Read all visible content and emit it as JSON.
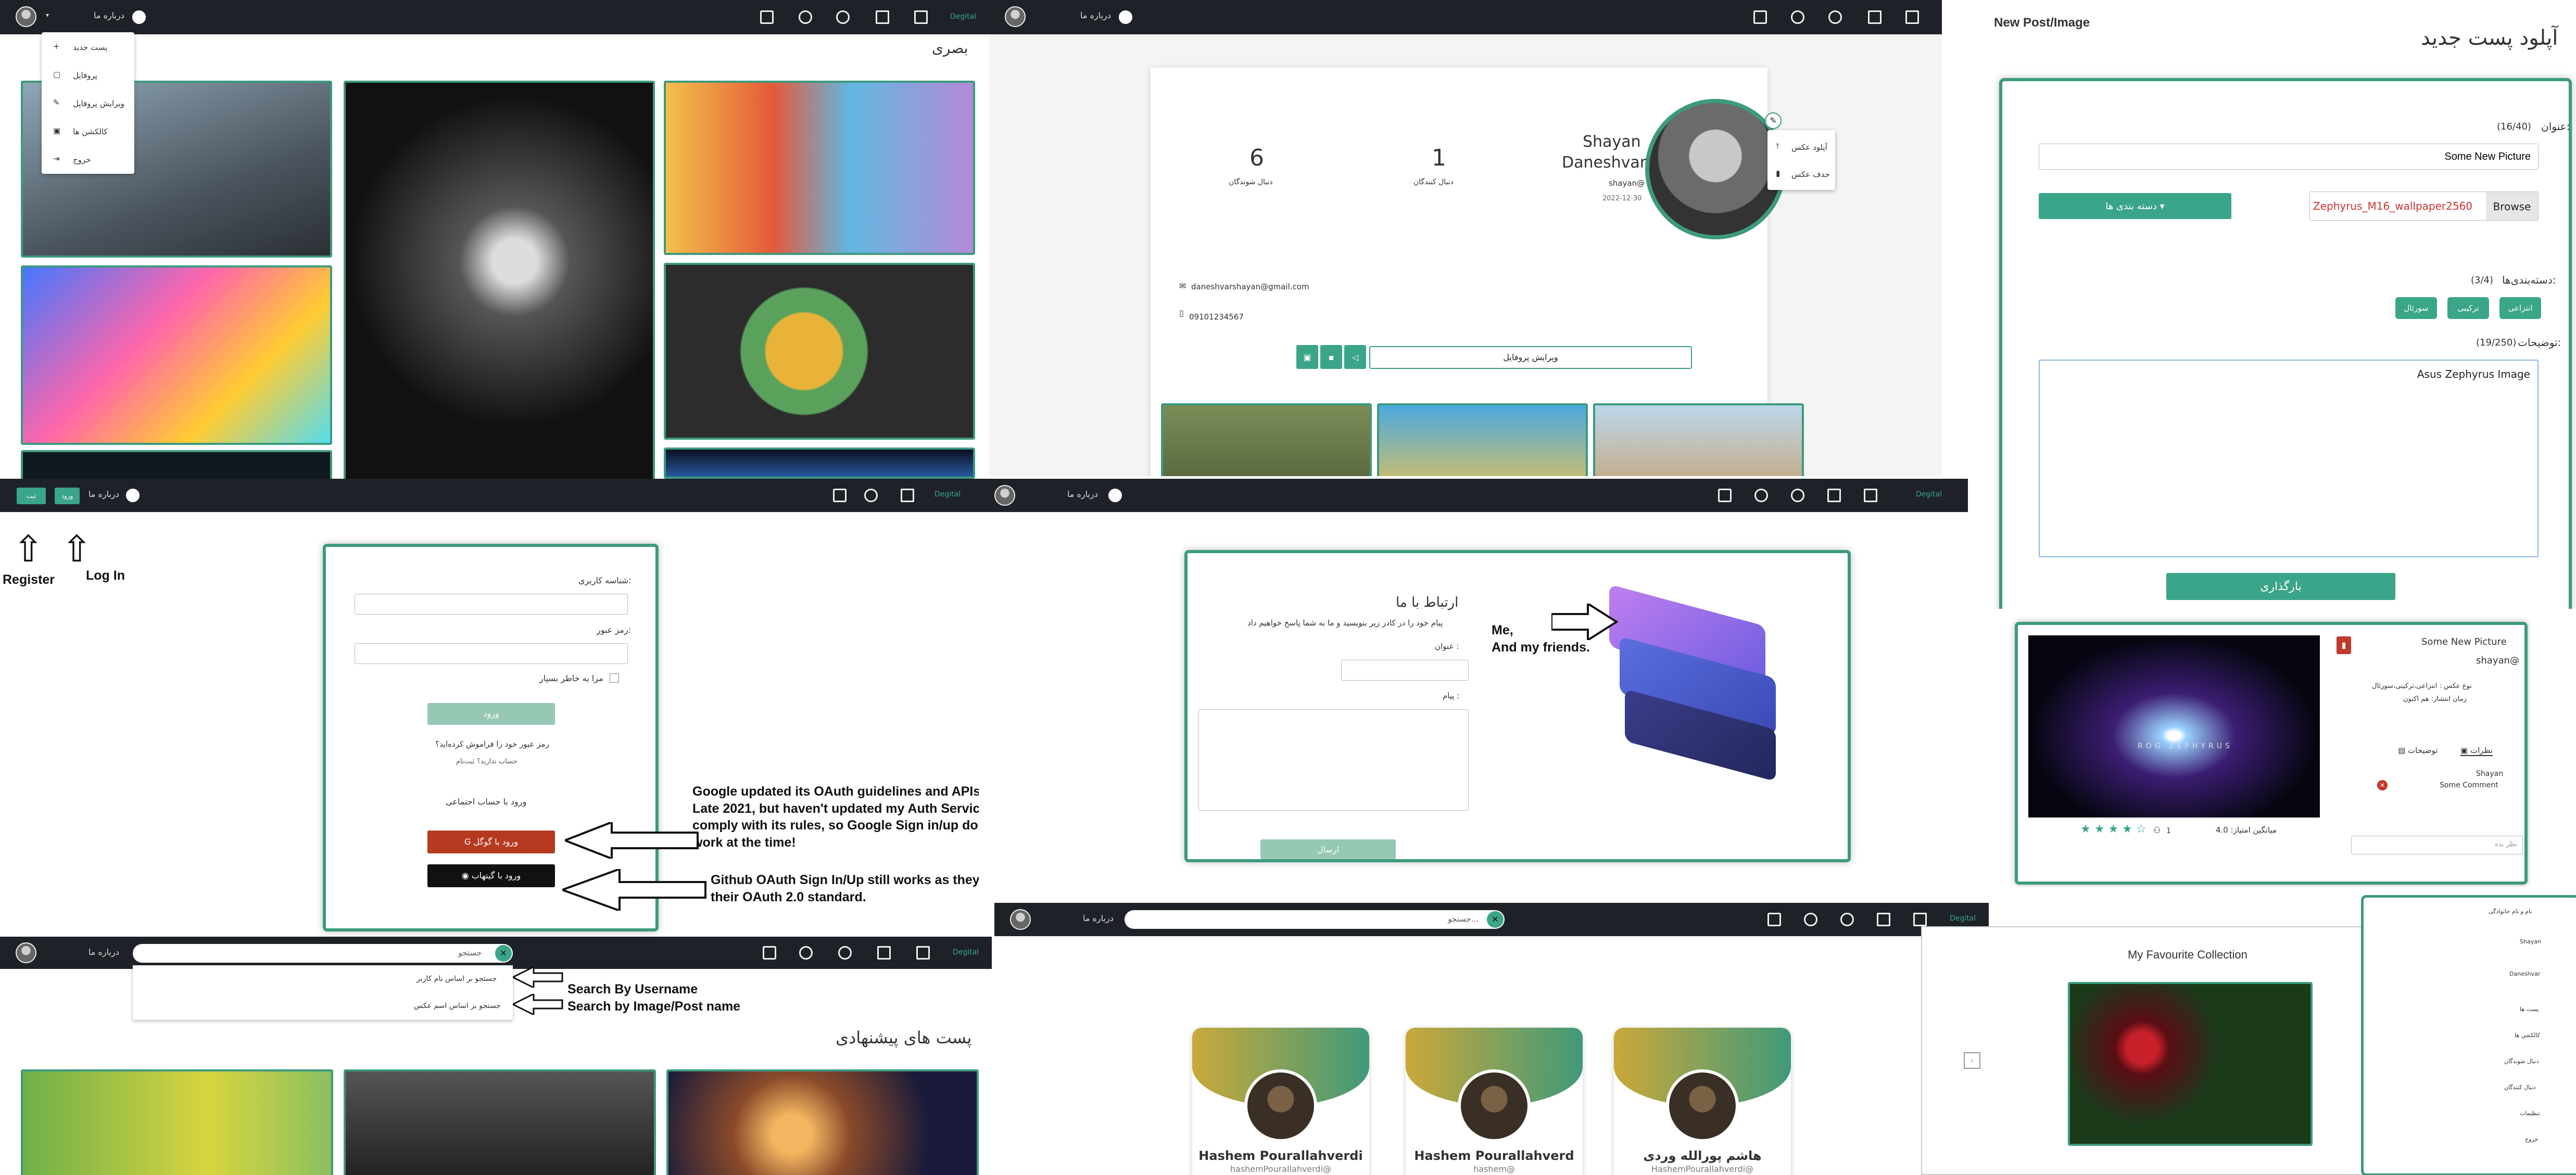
{
  "brand": "Degital",
  "nav_about": "درباره ما",
  "gallery": {
    "title": "بصری",
    "menu": [
      "پست جدید",
      "پروفایل",
      "ویرایش پروفایل",
      "کالکشن ها",
      "خروج"
    ]
  },
  "profile": {
    "first": "Shayan",
    "last": "Daneshvar",
    "username": "shayan@",
    "date": "2022-12-30",
    "followers_count": "1",
    "followers_label": "دنبال کنندگان",
    "following_count": "6",
    "following_label": "دنبال شوندگان",
    "email": "daneshvarshayan@gmail.com",
    "phone": "09101234567",
    "edit_button": "ویرایش پروفایل",
    "upload_photo": "آپلود عکس",
    "delete_photo": "حذف عکس"
  },
  "upload": {
    "caption_en": "New Post/Image",
    "title": "آپلود پست جدید",
    "title_label": "عنوان:",
    "title_count": "(16/40)",
    "title_value": "Some New Picture",
    "category_button": "دسته بندی ها",
    "file_value": "Zephyrus_M16_wallpaper2560",
    "browse": "Browse",
    "categories_label": "دسته‌بندی‌ها:",
    "categories_count": "(3/4)",
    "categories": [
      "انتزاعی",
      "ترکیبی",
      "سورئال"
    ],
    "desc_label": "توضیحات:",
    "desc_count": "(19/250)",
    "desc_value": "Asus Zephyrus Image",
    "submit": "بارگذاری"
  },
  "login": {
    "username_label": "شناسه کاربری:",
    "password_label": "رمز عبور:",
    "remember": "مرا به خاطر بسپار",
    "login_button": "ورود",
    "forgot": "رمز عبور خود را فراموش کرده‌اید؟",
    "no_account": "حساب ندارید؟ ثبت‌نام",
    "social_title": "ورود با حساب اجتماعی",
    "google": "ورود با گوگل",
    "github": "ورود با گیتهاب",
    "nav_btn1": "ثبت",
    "nav_btn2": "ورود",
    "register_note": "Register",
    "login_note": "Log In",
    "google_note": "Google updated its OAuth guidelines and APIs in Late 2021, but haven't updated my Auth Service to comply with its rules, so Google Sign in/up doesnt work at the time!",
    "github_note": "Github OAuth Sign In/Up still works as they kept their OAuth 2.0 standard."
  },
  "contact": {
    "title": "ارتباط با ما",
    "subtitle": "پیام خود را در کادر زیر بنویسید و ما به شما پاسخ خواهیم داد",
    "subject_label": "عنوان :",
    "message_label": "پیام :",
    "send": "ارسال",
    "note": "Me,\nAnd my friends."
  },
  "post": {
    "title": "Some New Picture",
    "user": "shayan@",
    "type": "نوع عکس : انتزاعی،ترکیبی،سورئال",
    "date": "زمان انتشار: هم اکنون",
    "tab_comments": "نظرات",
    "tab_desc": "توضیحات",
    "comment_user": "Shayan",
    "comment_text": "Some Comment",
    "comment_placeholder": "نظر بده",
    "rating_label": "میانگین امتیاز: 4.0",
    "likes": "1",
    "brand_text": "ROG ZEPHYRUS"
  },
  "search": {
    "placeholder": "جستجو",
    "opt_user": "جستجو بر اساس نام کاربر",
    "opt_image": "جستجو بر اساس اسم عکس",
    "note_user": "Search By Username",
    "note_image": "Search by Image/Post name",
    "suggested": "پست های پیشنهادی"
  },
  "users": {
    "placeholder": "جستجو...",
    "cards": [
      {
        "name": "هاشم پورالله وردی",
        "user": "HashemPourallahverdi@"
      },
      {
        "name": "Hashem Pourallahverd",
        "user": "hashem@"
      },
      {
        "name": "Hashem Pourallahverdi",
        "user": "hashemPourallahverdi@"
      }
    ]
  },
  "collection": {
    "title": "My Favourite Collection"
  },
  "sidebar": {
    "items": [
      "نام و نام خانوادگی",
      "Shayan",
      "Daneshvar",
      "پست ها",
      "کالکشن ها",
      "دنبال شوندگان",
      "دنبال کنندگان",
      "تنظیمات",
      "خروج"
    ]
  }
}
